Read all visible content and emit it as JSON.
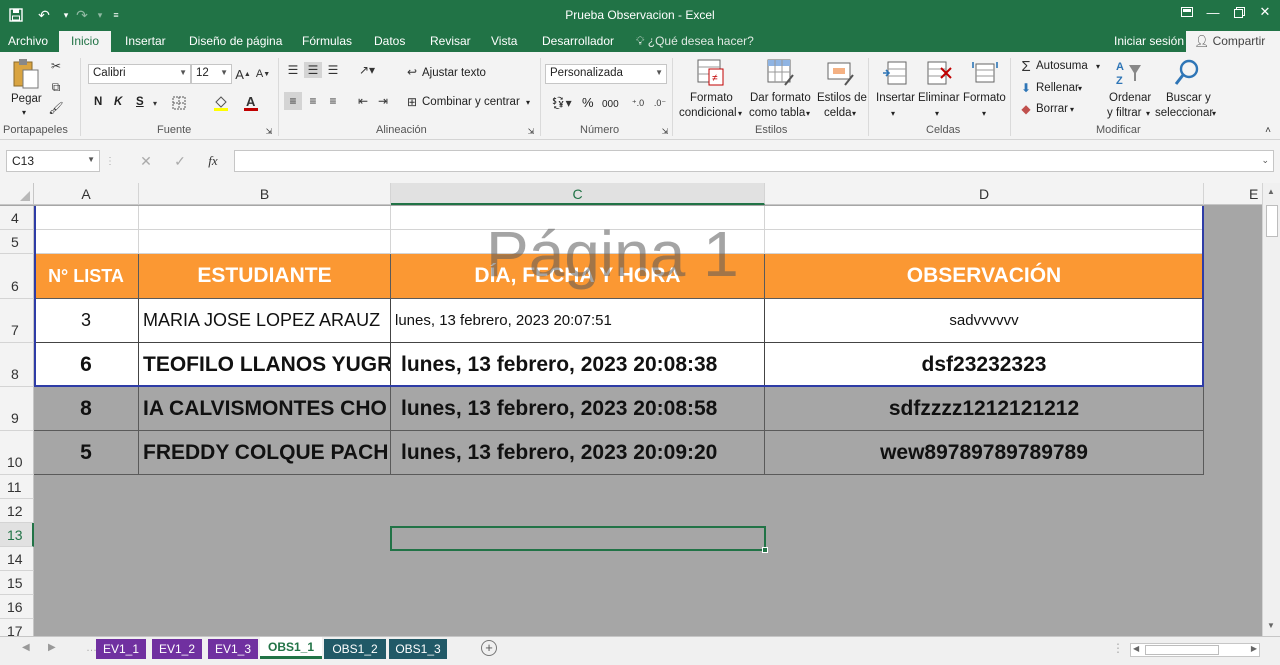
{
  "window": {
    "title": "Prueba Observacion - Excel"
  },
  "ribbon_tabs": [
    {
      "label": "Archivo"
    },
    {
      "label": "Inicio"
    },
    {
      "label": "Insertar"
    },
    {
      "label": "Diseño de página"
    },
    {
      "label": "Fórmulas"
    },
    {
      "label": "Datos"
    },
    {
      "label": "Revisar"
    },
    {
      "label": "Vista"
    },
    {
      "label": "Desarrollador"
    }
  ],
  "tell_me": "¿Qué desea hacer?",
  "account": {
    "signin": "Iniciar sesión",
    "share": "Compartir"
  },
  "ribbon": {
    "clipboard": {
      "paste": "Pegar",
      "label": "Portapapeles"
    },
    "font": {
      "name": "Calibri",
      "size": "12",
      "bold": "N",
      "italic": "K",
      "underline": "S",
      "label": "Fuente"
    },
    "alignment": {
      "wrap": "Ajustar texto",
      "merge": "Combinar y centrar",
      "label": "Alineación"
    },
    "number": {
      "format": "Personalizada",
      "percent": "%",
      "thousands": "000",
      "label": "Número"
    },
    "styles": {
      "conditional_1": "Formato",
      "conditional_2": "condicional",
      "table_1": "Dar formato",
      "table_2": "como tabla",
      "cell_1": "Estilos de",
      "cell_2": "celda",
      "label": "Estilos"
    },
    "cells": {
      "insert": "Insertar",
      "delete": "Eliminar",
      "format": "Formato",
      "label": "Celdas"
    },
    "editing": {
      "autosum": "Autosuma",
      "fill": "Rellenar",
      "clear": "Borrar",
      "sort_1": "Ordenar",
      "sort_2": "y filtrar",
      "find_1": "Buscar y",
      "find_2": "seleccionar",
      "label": "Modificar"
    }
  },
  "formula_bar": {
    "name_box": "C13",
    "fx": "fx",
    "formula": ""
  },
  "columns": [
    "A",
    "B",
    "C",
    "D",
    "E"
  ],
  "rows": [
    "4",
    "5",
    "6",
    "7",
    "8",
    "9",
    "10",
    "11",
    "12",
    "13",
    "14",
    "15",
    "16",
    "17"
  ],
  "watermark": "Página 1",
  "table": {
    "headers": [
      "N° LISTA",
      "ESTUDIANTE",
      "DÍA, FECHA Y HORA",
      "OBSERVACIÓN"
    ],
    "rows": [
      {
        "num": "3",
        "student": "MARIA JOSE LOPEZ ARAUZ",
        "date": "lunes, 13 febrero, 2023  20:07:51",
        "obs": "sadvvvvvv"
      },
      {
        "num": "6",
        "student": "TEOFILO LLANOS YUGRA",
        "date": "lunes, 13 febrero, 2023  20:08:38",
        "obs": "dsf23232323"
      },
      {
        "num": "8",
        "student": "IA CALVISMONTES CHO",
        "date": "lunes, 13 febrero, 2023  20:08:58",
        "obs": "sdfzzzz1212121212"
      },
      {
        "num": "5",
        "student": "FREDDY COLQUE PACH",
        "date": "lunes, 13 febrero, 2023  20:09:20",
        "obs": "wew89789789789789"
      }
    ]
  },
  "sheets": [
    {
      "label": "EV1_1",
      "color": "#7030a0"
    },
    {
      "label": "EV1_2",
      "color": "#7030a0"
    },
    {
      "label": "EV1_3",
      "color": "#7030a0"
    },
    {
      "label": "OBS1_1",
      "color": "#215967"
    },
    {
      "label": "OBS1_2",
      "color": "#215967"
    },
    {
      "label": "OBS1_3",
      "color": "#215967"
    }
  ],
  "active_sheet": "OBS1_1",
  "colors": {
    "brand": "#217346",
    "header_orange": "#fb9833",
    "page_frame": "#2e3ca6"
  }
}
